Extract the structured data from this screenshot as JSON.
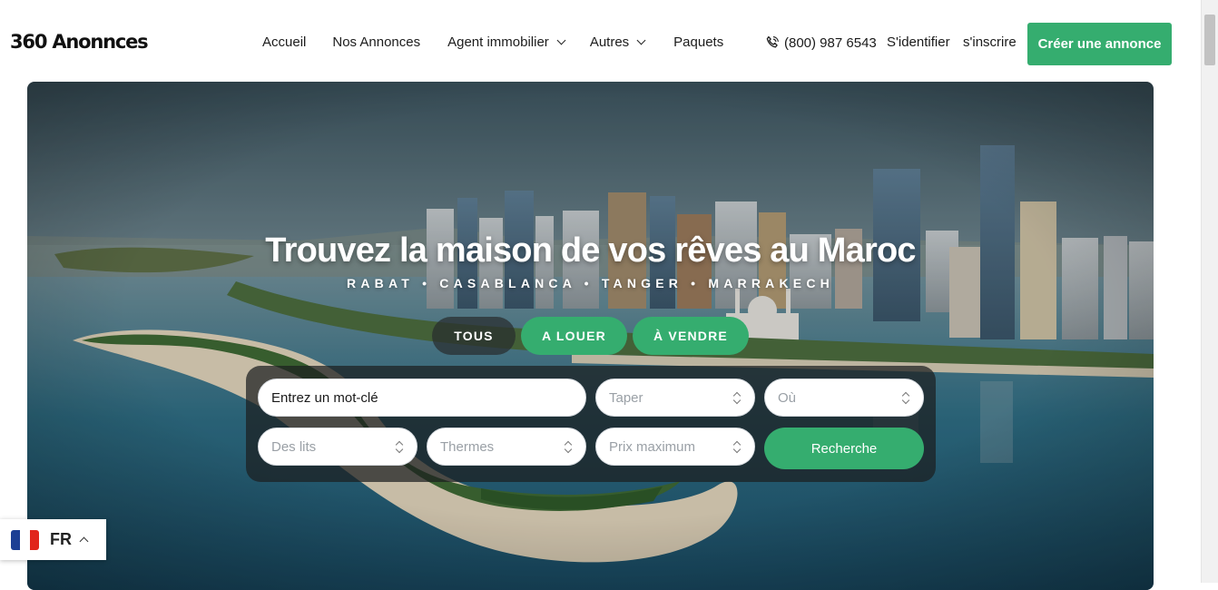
{
  "brand": {
    "logo_text": "360 Anonnces"
  },
  "nav": {
    "items": [
      {
        "label": "Accueil",
        "dropdown": false
      },
      {
        "label": "Nos Annonces",
        "dropdown": false
      },
      {
        "label": "Agent immobilier",
        "dropdown": true
      },
      {
        "label": "Autres",
        "dropdown": true
      },
      {
        "label": "Paquets",
        "dropdown": false
      }
    ],
    "phone": "(800) 987 6543",
    "login_label": "S'identifier",
    "register_label": "s'inscrire",
    "cta_label": "Créer une annonce"
  },
  "hero": {
    "title": "Trouvez la maison de vos rêves au Maroc",
    "subtitle": "RABAT • CASABLANCA • TANGER • MARRAKECH",
    "tabs": [
      {
        "label": "TOUS",
        "active": false
      },
      {
        "label": "A LOUER",
        "active": true
      },
      {
        "label": "À VENDRE",
        "active": true
      }
    ]
  },
  "search": {
    "keyword_placeholder": "Entrez un mot-clé",
    "type_placeholder": "Taper",
    "location_placeholder": "Où",
    "beds_placeholder": "Des lits",
    "baths_placeholder": "Thermes",
    "max_price_placeholder": "Prix maximum",
    "submit_label": "Recherche"
  },
  "language": {
    "code": "FR",
    "flag_colors": [
      "#1c3f94",
      "#ffffff",
      "#e1251b"
    ]
  },
  "colors": {
    "accent": "#35ad6f",
    "panel": "#1c1e20"
  }
}
